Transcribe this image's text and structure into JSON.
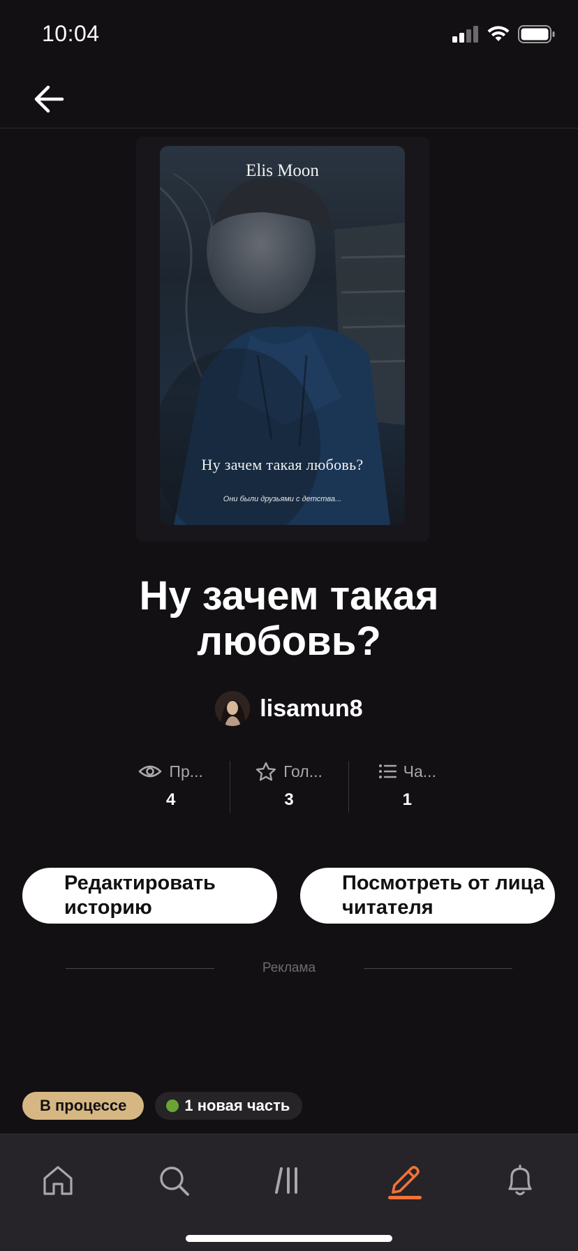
{
  "status_bar": {
    "time": "10:04"
  },
  "book": {
    "cover_author": "Elis Moon",
    "cover_title": "Ну зачем такая любовь?",
    "cover_tagline": "Они были друзьями с детства...",
    "title": "Ну зачем такая любовь?",
    "author": "lisamun8"
  },
  "stats": [
    {
      "icon": "eye-icon",
      "label": "Пр...",
      "value": "4"
    },
    {
      "icon": "star-icon",
      "label": "Гол...",
      "value": "3"
    },
    {
      "icon": "list-icon",
      "label": "Ча...",
      "value": "1"
    }
  ],
  "actions": {
    "edit_label": "Редактировать историю",
    "preview_label": "Посмотреть от лица читателя"
  },
  "ad": {
    "label": "Реклама"
  },
  "badges": {
    "status": "В процессе",
    "new_parts": "1 новая часть"
  },
  "tabbar": {
    "items": [
      "home-icon",
      "search-icon",
      "library-icon",
      "write-icon",
      "bell-icon"
    ],
    "active": "write-icon"
  },
  "colors": {
    "background": "#121013",
    "accent": "#f2733a",
    "status_badge": "#d6b783",
    "new_dot": "#6aa534"
  }
}
